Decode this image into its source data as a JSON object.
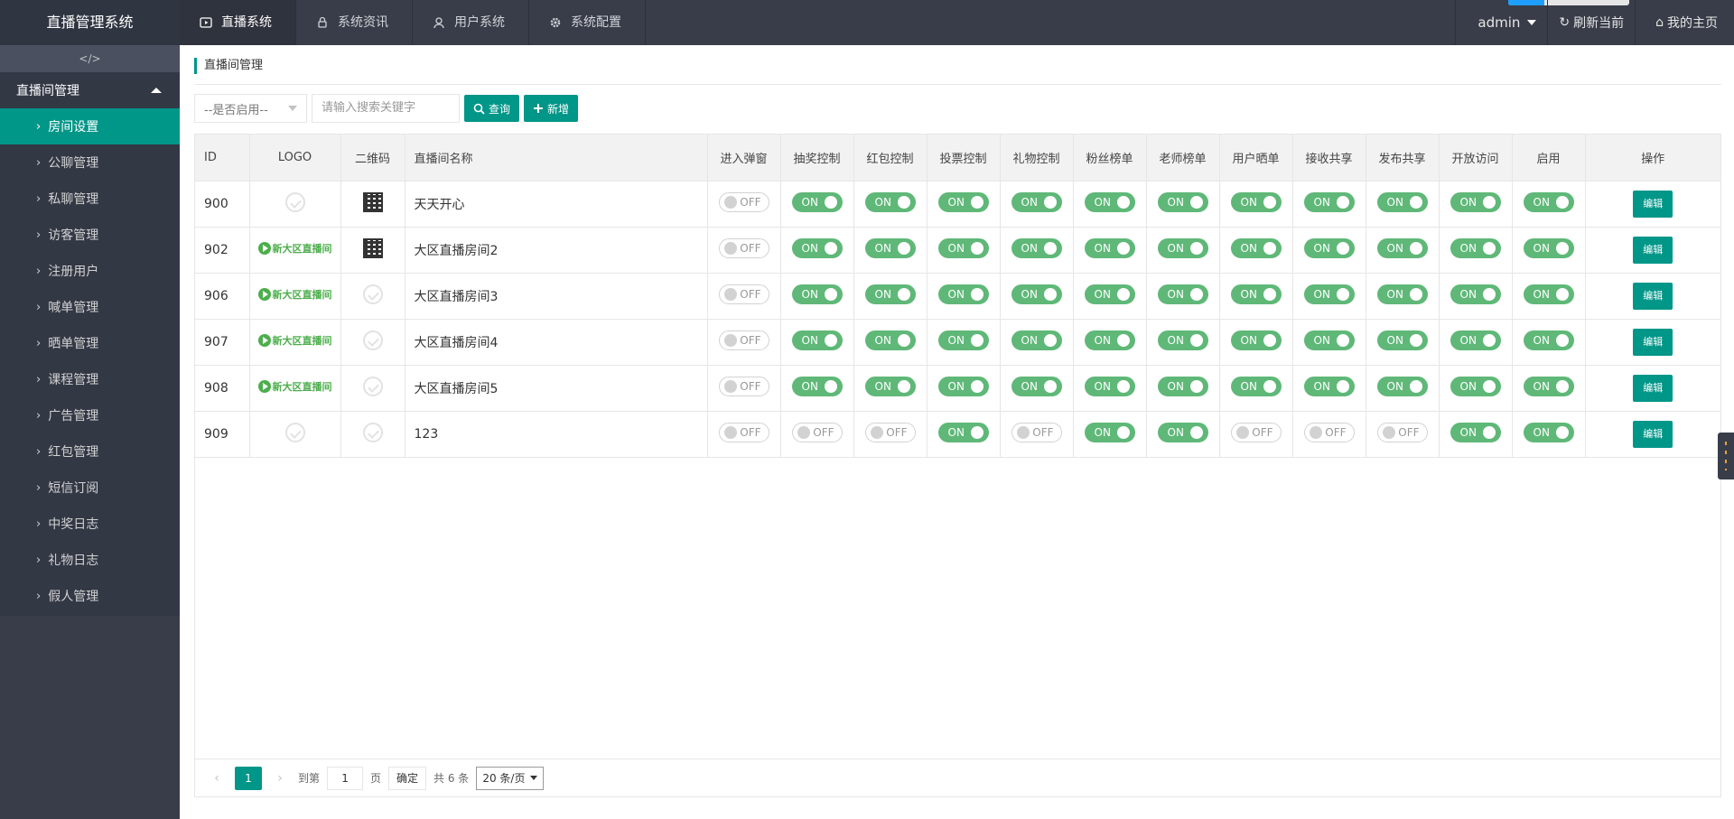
{
  "app": {
    "title": "直播管理系统"
  },
  "topnav": [
    {
      "label": "直播系统",
      "icon": "play-icon",
      "active": true
    },
    {
      "label": "系统资讯",
      "icon": "lock-icon",
      "active": false
    },
    {
      "label": "用户系统",
      "icon": "user-icon",
      "active": false
    },
    {
      "label": "系统配置",
      "icon": "gear-icon",
      "active": false
    }
  ],
  "topright": {
    "user": "admin",
    "refresh": "刷新当前",
    "home": "我的主页"
  },
  "sidebar": {
    "shrink": "</>",
    "group": "直播间管理",
    "items": [
      {
        "label": "房间设置",
        "active": true
      },
      {
        "label": "公聊管理"
      },
      {
        "label": "私聊管理"
      },
      {
        "label": "访客管理"
      },
      {
        "label": "注册用户"
      },
      {
        "label": "喊单管理"
      },
      {
        "label": "晒单管理"
      },
      {
        "label": "课程管理"
      },
      {
        "label": "广告管理"
      },
      {
        "label": "红包管理"
      },
      {
        "label": "短信订阅"
      },
      {
        "label": "中奖日志"
      },
      {
        "label": "礼物日志"
      },
      {
        "label": "假人管理"
      }
    ]
  },
  "page": {
    "title": "直播间管理"
  },
  "search": {
    "select": "--是否启用--",
    "placeholder": "请输入搜索关键字",
    "query": "查询",
    "add": "新增"
  },
  "table": {
    "headers": [
      "ID",
      "LOGO",
      "二维码",
      "直播间名称",
      "进入弹窗",
      "抽奖控制",
      "红包控制",
      "投票控制",
      "礼物控制",
      "粉丝榜单",
      "老师榜单",
      "用户晒单",
      "接收共享",
      "发布共享",
      "开放访问",
      "启用",
      "操作"
    ],
    "logo_text": "新大区直播间",
    "on": "ON",
    "off": "OFF",
    "edit": "编辑",
    "rows": [
      {
        "id": "900",
        "logo": false,
        "qr": true,
        "name": "天天开心",
        "sw": [
          0,
          1,
          1,
          1,
          1,
          1,
          1,
          1,
          1,
          1,
          1,
          1
        ]
      },
      {
        "id": "902",
        "logo": true,
        "qr": true,
        "name": "大区直播房间2",
        "sw": [
          0,
          1,
          1,
          1,
          1,
          1,
          1,
          1,
          1,
          1,
          1,
          1
        ]
      },
      {
        "id": "906",
        "logo": true,
        "qr": false,
        "name": "大区直播房间3",
        "sw": [
          0,
          1,
          1,
          1,
          1,
          1,
          1,
          1,
          1,
          1,
          1,
          1
        ]
      },
      {
        "id": "907",
        "logo": true,
        "qr": false,
        "name": "大区直播房间4",
        "sw": [
          0,
          1,
          1,
          1,
          1,
          1,
          1,
          1,
          1,
          1,
          1,
          1
        ]
      },
      {
        "id": "908",
        "logo": true,
        "qr": false,
        "name": "大区直播房间5",
        "sw": [
          0,
          1,
          1,
          1,
          1,
          1,
          1,
          1,
          1,
          1,
          1,
          1
        ]
      },
      {
        "id": "909",
        "logo": false,
        "qr": false,
        "name": "123",
        "sw": [
          0,
          0,
          0,
          1,
          0,
          1,
          1,
          0,
          0,
          0,
          1,
          1
        ]
      }
    ]
  },
  "pager": {
    "prev": "‹",
    "current": "1",
    "next": "›",
    "goto": "到第",
    "page_input": "1",
    "page_unit": "页",
    "confirm": "确定",
    "total": "共 6 条",
    "per_page": "20 条/页"
  },
  "colors": {
    "primary": "#009688",
    "switch_on": "#5fb878",
    "topbar": "#393d49"
  }
}
